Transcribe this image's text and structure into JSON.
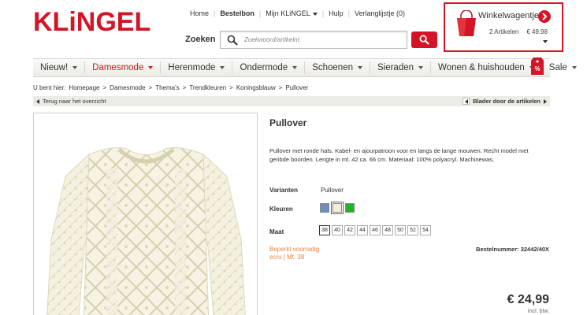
{
  "brand": {
    "logo_text": "KLiNGEL",
    "accent": "#d41527"
  },
  "toplinks": [
    {
      "label": "Home"
    },
    {
      "label": "Bestelbon"
    },
    {
      "label": "Mijn KLiNGEL"
    },
    {
      "label": "Hulp"
    },
    {
      "label": "Verlanglijstje (0)"
    }
  ],
  "search": {
    "label": "Zoeken",
    "placeholder": "Zoekwoord/artikelnr."
  },
  "cart": {
    "title": "Winkelwagentje",
    "count": "2 Artikelen",
    "total": "€ 49,98"
  },
  "nav": [
    {
      "label": "Nieuw!"
    },
    {
      "label": "Damesmode"
    },
    {
      "label": "Herenmode"
    },
    {
      "label": "Ondermode"
    },
    {
      "label": "Schoenen"
    },
    {
      "label": "Sieraden"
    },
    {
      "label": "Wonen & huishouden"
    },
    {
      "label": "Sale"
    }
  ],
  "breadcrumb": {
    "prefix": "U bent hier:",
    "items": [
      "Homepage",
      "Damesmode",
      "Thema's",
      "Trendkleuren",
      "Koningsblauw",
      "Pullover"
    ],
    "sep": ">"
  },
  "actions": {
    "back": "Terug naar het overzicht",
    "browse": "Blader door de artikelen"
  },
  "product": {
    "title": "Pullover",
    "description": "Pullover met ronde hals. Kabel- en ajourpatroon voor en langs de lange mouwen. Recht model met geribde boorden. Lengte in mt. 42 ca. 66 cm. Materiaal: 100% polyacryl. Machinewas.",
    "variants_label": "Varianten",
    "variants_value": "Pullover",
    "colors_label": "Kleuren",
    "colors": [
      "#6b8fbf",
      "#f3efd9",
      "#22b422"
    ],
    "size_label": "Maat",
    "sizes": [
      "38",
      "40",
      "42",
      "44",
      "46",
      "48",
      "50",
      "52",
      "54"
    ],
    "stock_status": "Beperkt voorradig",
    "selection": "ecru | Mt. 38",
    "article_number": "Bestelnummer: 32442/40X",
    "price": "€ 24,99",
    "vat": "Incl. btw."
  }
}
